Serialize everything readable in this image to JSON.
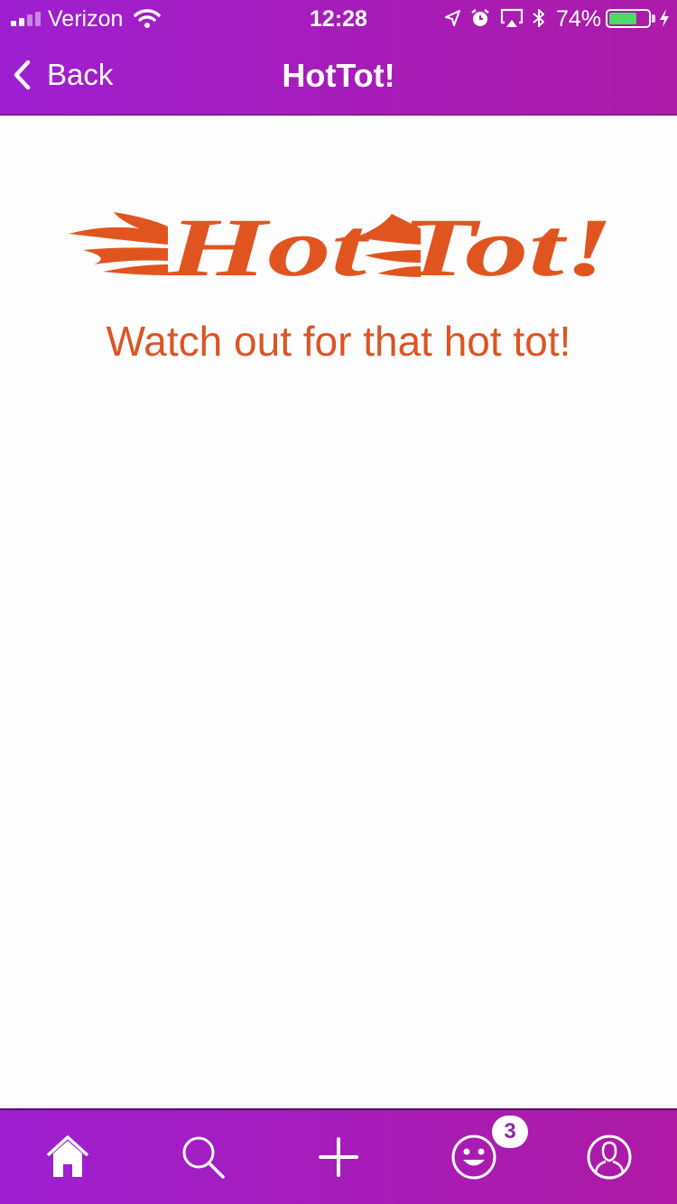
{
  "status_bar": {
    "carrier": "Verizon",
    "time": "12:28",
    "battery_percent": "74%",
    "battery_level": 0.74
  },
  "nav": {
    "back_label": "Back",
    "title": "HotTot!"
  },
  "main": {
    "logo_text": "Hot Tot!",
    "tagline": "Watch out for that hot tot!"
  },
  "tab_bar": {
    "tabs": [
      {
        "icon": "home-icon",
        "selected": true
      },
      {
        "icon": "search-icon",
        "selected": false
      },
      {
        "icon": "plus-icon",
        "selected": false
      },
      {
        "icon": "smiley-icon",
        "selected": false,
        "badge": "3"
      },
      {
        "icon": "profile-icon",
        "selected": false
      }
    ]
  },
  "colors": {
    "bar_gradient_start": "#9e1fd0",
    "bar_gradient_end": "#ac1ba8",
    "brand_orange": "#db5523",
    "battery_green": "#4cd964"
  }
}
